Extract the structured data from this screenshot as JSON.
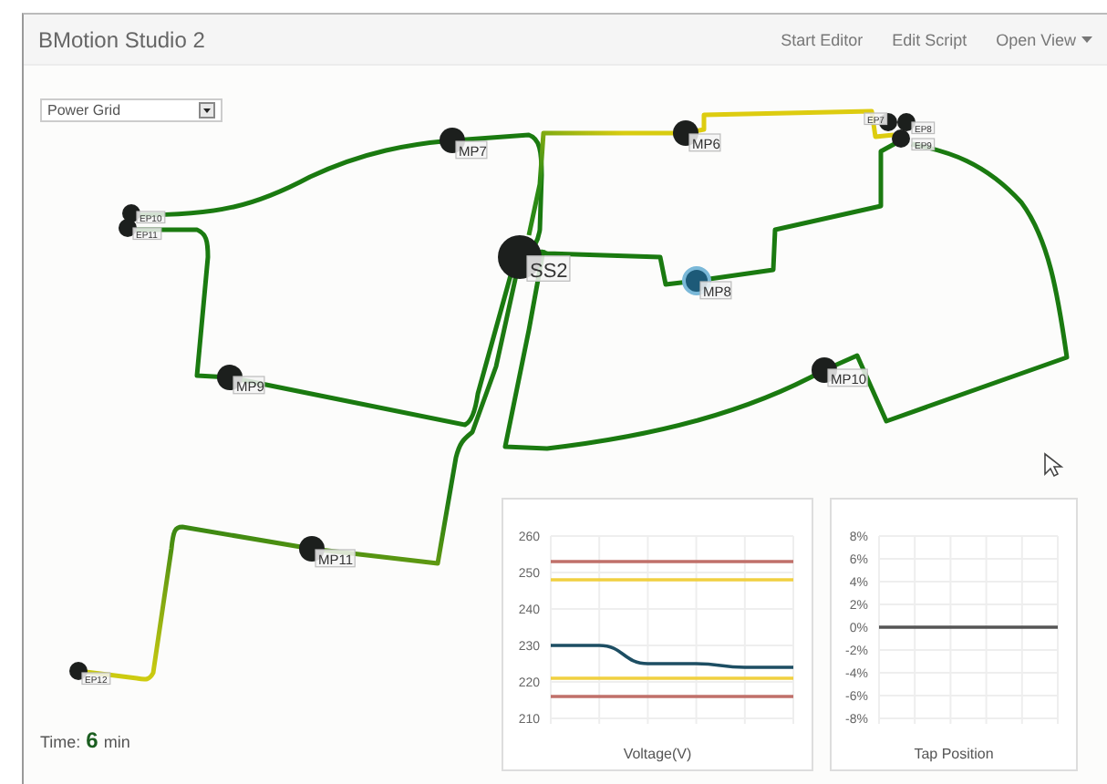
{
  "navbar": {
    "title": "BMotion Studio 2",
    "links": [
      {
        "label": "Start Editor",
        "dropdown": false
      },
      {
        "label": "Edit Script",
        "dropdown": false
      },
      {
        "label": "Open View",
        "dropdown": true
      }
    ]
  },
  "view_select": {
    "value": "Power Grid"
  },
  "nodes": [
    {
      "label": "MP7",
      "kind": "measure",
      "selected": false
    },
    {
      "label": "EP10",
      "kind": "end",
      "selected": false
    },
    {
      "label": "EP11",
      "kind": "end",
      "selected": false
    },
    {
      "label": "SS2",
      "kind": "substation",
      "selected": false
    },
    {
      "label": "MP9",
      "kind": "measure",
      "selected": false
    },
    {
      "label": "MP6",
      "kind": "measure",
      "selected": false
    },
    {
      "label": "EP7",
      "kind": "end",
      "selected": false
    },
    {
      "label": "EP8",
      "kind": "end",
      "selected": false
    },
    {
      "label": "EP9",
      "kind": "end",
      "selected": false
    },
    {
      "label": "MP8",
      "kind": "measure",
      "selected": true
    },
    {
      "label": "MP10",
      "kind": "measure",
      "selected": false
    },
    {
      "label": "MP11",
      "kind": "measure",
      "selected": false
    },
    {
      "label": "EP12",
      "kind": "end",
      "selected": false
    }
  ],
  "time": {
    "label": "Time:",
    "value": "6",
    "unit": "min"
  },
  "charts": [
    {
      "chart_data": {
        "type": "line",
        "title": "Voltage(V)",
        "grid": true,
        "ylim": [
          210,
          260
        ],
        "yticks": [
          210,
          220,
          230,
          240,
          250,
          260
        ],
        "series": [
          {
            "color": "#c0706a",
            "values": [
              253,
              253,
              253,
              253,
              253,
              253
            ]
          },
          {
            "color": "#f0d040",
            "values": [
              248,
              248,
              248,
              248,
              248,
              248
            ]
          },
          {
            "color": "#1d4e63",
            "values": [
              230,
              230,
              225,
              225,
              224,
              224
            ]
          },
          {
            "color": "#f0d040",
            "values": [
              221,
              221,
              221,
              221,
              221,
              221
            ]
          },
          {
            "color": "#c0706a",
            "values": [
              216,
              216,
              216,
              216,
              216,
              216
            ]
          }
        ]
      }
    },
    {
      "chart_data": {
        "type": "line",
        "title": "Tap Position",
        "grid": true,
        "ylim": [
          -8,
          8
        ],
        "yticks": [
          {
            "value": -8,
            "label": "-8%"
          },
          {
            "value": -6,
            "label": "-6%"
          },
          {
            "value": -4,
            "label": "-4%"
          },
          {
            "value": -2,
            "label": "-2%"
          },
          {
            "value": 0,
            "label": "0%"
          },
          {
            "value": 2,
            "label": "2%"
          },
          {
            "value": 4,
            "label": "4%"
          },
          {
            "value": 6,
            "label": "6%"
          },
          {
            "value": 8,
            "label": "8%"
          }
        ],
        "series": [
          {
            "color": "#555555",
            "values": [
              0,
              0,
              0,
              0,
              0,
              0
            ]
          }
        ]
      }
    }
  ]
}
